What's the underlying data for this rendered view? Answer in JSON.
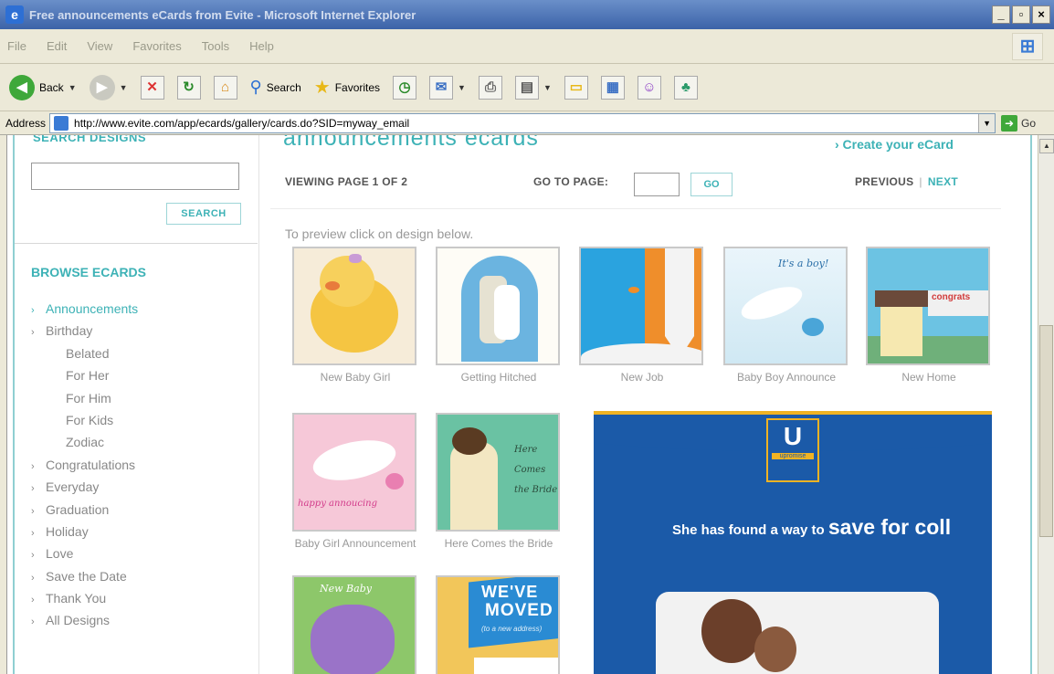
{
  "window": {
    "title": "Free announcements eCards from Evite - Microsoft Internet Explorer",
    "min_label": "_",
    "max_label": "▫",
    "close_label": "×"
  },
  "menu": {
    "items": [
      "File",
      "Edit",
      "View",
      "Favorites",
      "Tools",
      "Help"
    ]
  },
  "toolbar": {
    "back_label": "Back",
    "search_label": "Search",
    "favorites_label": "Favorites"
  },
  "address": {
    "label": "Address",
    "url": "http://www.evite.com/app/ecards/gallery/cards.do?SID=myway_email",
    "go_label": "Go"
  },
  "sidebar": {
    "search_heading": "SEARCH DESIGNS",
    "search_value": "",
    "search_button": "SEARCH",
    "browse_heading": "BROWSE ECARDS",
    "items": [
      {
        "label": "Announcements",
        "chevron": "›",
        "active": true,
        "sub": false
      },
      {
        "label": "Birthday",
        "chevron": "›",
        "active": false,
        "sub": false
      },
      {
        "label": "Belated",
        "chevron": "",
        "active": false,
        "sub": true
      },
      {
        "label": "For Her",
        "chevron": "",
        "active": false,
        "sub": true
      },
      {
        "label": "For Him",
        "chevron": "",
        "active": false,
        "sub": true
      },
      {
        "label": "For Kids",
        "chevron": "",
        "active": false,
        "sub": true
      },
      {
        "label": "Zodiac",
        "chevron": "",
        "active": false,
        "sub": true
      },
      {
        "label": "Congratulations",
        "chevron": "›",
        "active": false,
        "sub": false
      },
      {
        "label": "Everyday",
        "chevron": "›",
        "active": false,
        "sub": false
      },
      {
        "label": "Graduation",
        "chevron": "›",
        "active": false,
        "sub": false
      },
      {
        "label": "Holiday",
        "chevron": "›",
        "active": false,
        "sub": false
      },
      {
        "label": "Love",
        "chevron": "›",
        "active": false,
        "sub": false
      },
      {
        "label": "Save the Date",
        "chevron": "›",
        "active": false,
        "sub": false
      },
      {
        "label": "Thank You",
        "chevron": "›",
        "active": false,
        "sub": false
      },
      {
        "label": "All Designs",
        "chevron": "›",
        "active": false,
        "sub": false
      }
    ]
  },
  "main": {
    "heading": "announcements ecards",
    "create_link": "› Create your eCard",
    "viewing": "VIEWING PAGE 1 OF 2",
    "goto_label": "GO TO PAGE:",
    "goto_value": "",
    "go_button": "GO",
    "previous": "PREVIOUS",
    "separator": "|",
    "next": "NEXT",
    "preview_text": "To preview click on design below."
  },
  "cards": [
    {
      "label": "New Baby Girl"
    },
    {
      "label": "Getting Hitched"
    },
    {
      "label": "New Job"
    },
    {
      "label": "Baby Boy Announce"
    },
    {
      "label": "New Home",
      "art_text": "congrats"
    },
    {
      "label": "Baby Girl Announcement",
      "art_text": "happy annoucing"
    },
    {
      "label": "Here Comes the Bride",
      "art_text": "Here Comes the Bride"
    },
    {
      "label": "",
      "art_text": "New Baby"
    },
    {
      "label": "",
      "art_text": "WE'VE MOVED"
    }
  ],
  "card_art": {
    "boy_text": "It's a boy!",
    "moved_line1": "WE'VE",
    "moved_line2": "MOVED",
    "moved_sub": "(to a new address)"
  },
  "ad": {
    "logo_letter": "U",
    "logo_brand": "upromise",
    "headline_start": "She has found a way to ",
    "headline_bold": "save for coll"
  }
}
